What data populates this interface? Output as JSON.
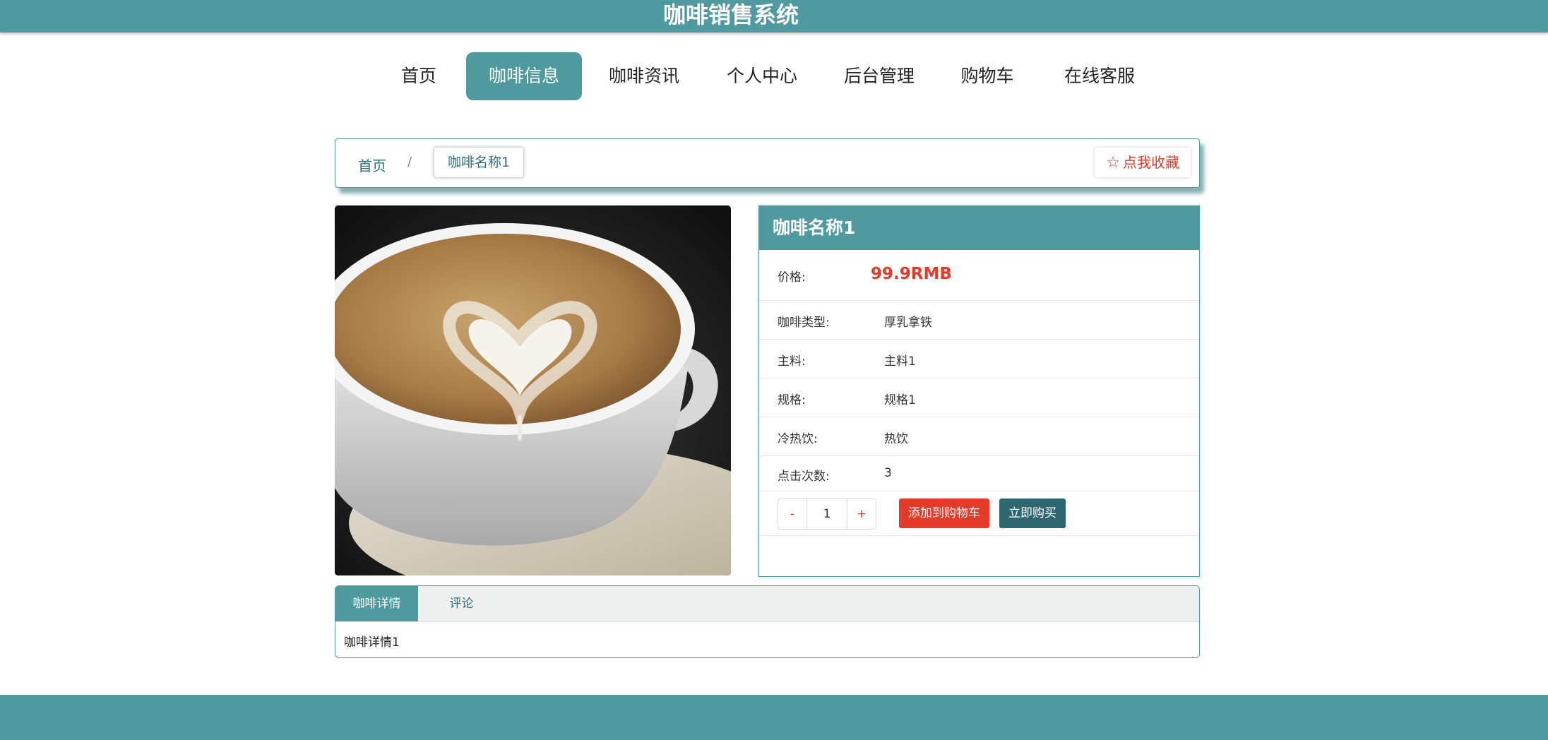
{
  "header": {
    "title": "咖啡销售系统"
  },
  "nav": {
    "items": [
      {
        "label": "首页"
      },
      {
        "label": "咖啡信息"
      },
      {
        "label": "咖啡资讯"
      },
      {
        "label": "个人中心"
      },
      {
        "label": "后台管理"
      },
      {
        "label": "购物车"
      },
      {
        "label": "在线客服"
      }
    ],
    "active": "咖啡信息"
  },
  "breadcrumb": {
    "home": "首页",
    "separator": "/",
    "current": "咖啡名称1"
  },
  "favorite": {
    "icon": "star-outline-icon",
    "label": "点我收藏"
  },
  "product": {
    "name": "咖啡名称1",
    "price_label": "价格:",
    "price": "99.9RMB",
    "fields": [
      {
        "label": "咖啡类型:",
        "value": "厚乳拿铁"
      },
      {
        "label": "主料:",
        "value": "主料1"
      },
      {
        "label": "规格:",
        "value": "规格1"
      },
      {
        "label": "冷热饮:",
        "value": "热饮"
      },
      {
        "label": "点击次数:",
        "value": "3"
      }
    ],
    "quantity": {
      "minus": "-",
      "value": "1",
      "plus": "+"
    },
    "add_to_cart": "添加到购物车",
    "buy_now": "立即购买"
  },
  "tabs": {
    "items": [
      {
        "label": "咖啡详情"
      },
      {
        "label": "评论"
      }
    ],
    "active": "咖啡详情",
    "content": "咖啡详情1"
  },
  "colors": {
    "primary": "#4e9a9e",
    "accent": "#e53a2a",
    "dark_button": "#2f6770"
  }
}
